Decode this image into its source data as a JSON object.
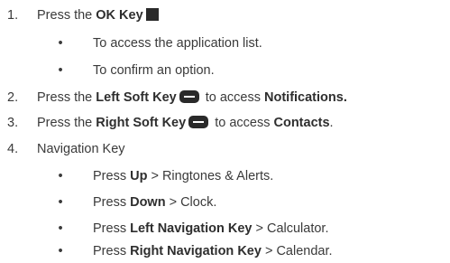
{
  "items": [
    {
      "number": "1.",
      "prefix": "Press the ",
      "bold": "OK Key",
      "icon": "ok-key-square-icon",
      "subitems": [
        "To access the application list.",
        "To confirm an option."
      ]
    },
    {
      "number": "2.",
      "prefix": "Press the ",
      "bold": "Left Soft Key",
      "icon": "soft-key-icon",
      "mid": " to access ",
      "bold2": "Notifications."
    },
    {
      "number": "3.",
      "prefix": "Press the ",
      "bold": "Right Soft Key",
      "icon": "soft-key-icon",
      "mid": " to access ",
      "bold2": "Contacts",
      "suffix": "."
    },
    {
      "number": "4.",
      "text": "Navigation Key",
      "subitems": [
        {
          "prefix": "Press ",
          "bold": "Up",
          "suffix": " > Ringtones & Alerts."
        },
        {
          "prefix": "Press ",
          "bold": "Down",
          "suffix": " > Clock."
        },
        {
          "prefix": "Press ",
          "bold": "Left Navigation Key",
          "suffix": " > Calculator."
        },
        {
          "prefix": "Press ",
          "bold": "Right Navigation Key",
          "suffix": " > Calendar."
        }
      ]
    }
  ],
  "bullet_char": "•",
  "colors": {
    "text": "#3a3a3a",
    "key_icon": "#2a2a2a"
  }
}
